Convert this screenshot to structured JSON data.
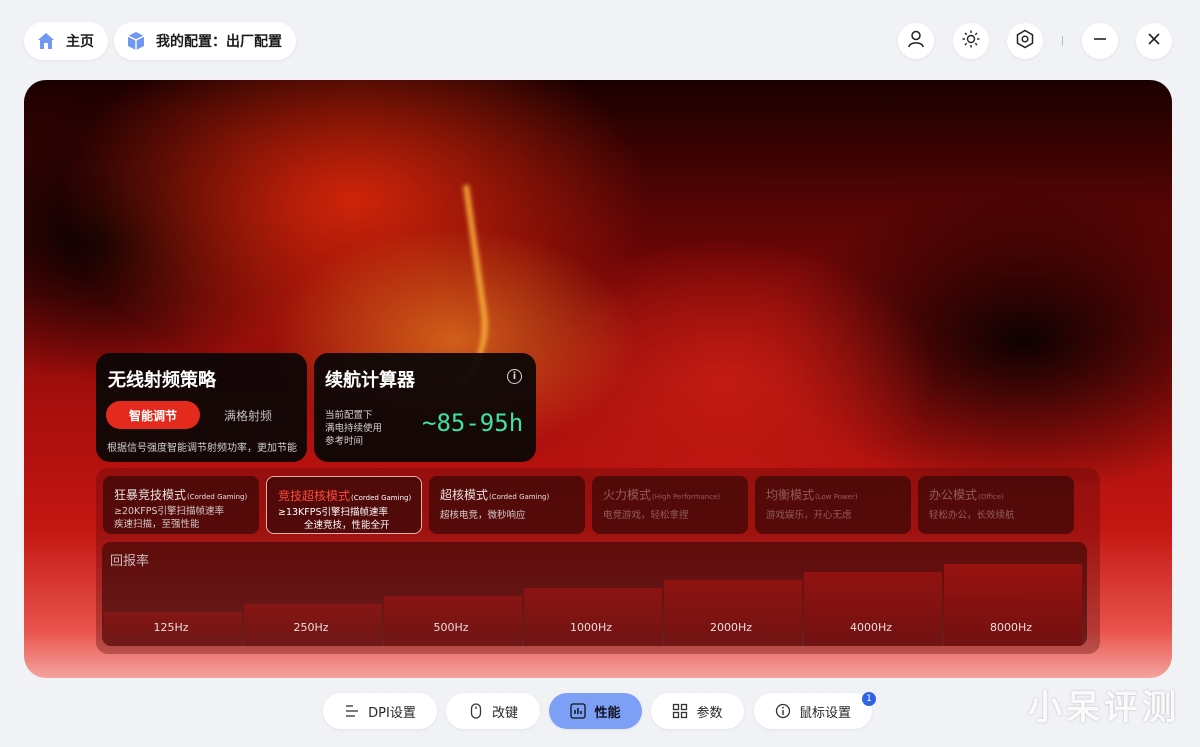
{
  "header": {
    "home_label": "主页",
    "profile_label": "我的配置：出厂配置"
  },
  "wireless_card": {
    "title": "无线射频策略",
    "active_option": "智能调节",
    "inactive_option": "满格射频",
    "description": "根据信号强度智能调节射频功率，更加节能"
  },
  "battery_card": {
    "title": "续航计算器",
    "lines": [
      "当前配置下",
      "满电持续使用",
      "参考时间"
    ],
    "value": "~85-95h"
  },
  "modes": [
    {
      "name": "狂暴竞技模式",
      "en": "(Corded Gaming)",
      "desc": [
        "≥20KFPS引擎扫描帧速率",
        "疾速扫描，至强性能"
      ]
    },
    {
      "name": "竞技超核模式",
      "en": "(Corded Gaming)",
      "desc": [
        "≥13KFPS引擎扫描帧速率",
        "全速竞技，性能全开"
      ]
    },
    {
      "name": "超核模式",
      "en": "(Corded Gaming)",
      "desc": [
        "超核电竞，微秒响应"
      ]
    },
    {
      "name": "火力模式",
      "en": "(High Performance)",
      "desc": [
        "电竞游戏，轻松拿捏"
      ]
    },
    {
      "name": "均衡模式",
      "en": "(Low Power)",
      "desc": [
        "游戏娱乐，开心无虑"
      ]
    },
    {
      "name": "办公模式",
      "en": "(Office)",
      "desc": [
        "轻松办公，长效续航"
      ]
    }
  ],
  "polling": {
    "title": "回报率",
    "rates": [
      "125Hz",
      "250Hz",
      "500Hz",
      "1000Hz",
      "2000Hz",
      "4000Hz",
      "8000Hz"
    ]
  },
  "tabs": {
    "dpi": "DPI设置",
    "keys": "改键",
    "performance": "性能",
    "params": "参数",
    "mouse": "鼠标设置",
    "mouse_badge": "1"
  },
  "watermark": "小呆评测",
  "colors": {
    "accent": "#e32a1c",
    "battery": "#3fe2a2",
    "tab_active": "#7e9ff6"
  }
}
